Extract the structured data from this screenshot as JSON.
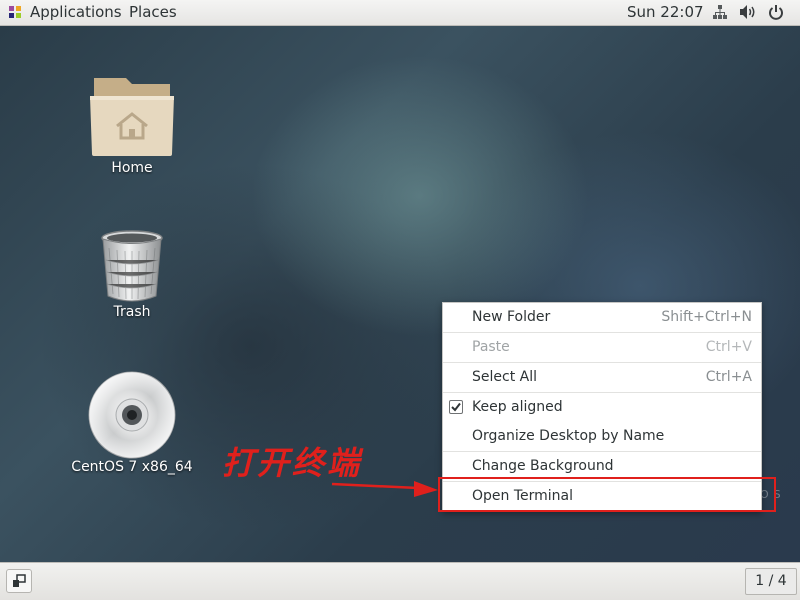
{
  "topbar": {
    "applications_label": "Applications",
    "places_label": "Places",
    "clock": "Sun 22:07",
    "tray_icons": [
      "network-icon",
      "volume-icon",
      "power-icon"
    ]
  },
  "desktop": {
    "icons": [
      {
        "label": "Home",
        "icon": "home-folder-icon"
      },
      {
        "label": "Trash",
        "icon": "trash-icon"
      },
      {
        "label": "CentOS 7 x86_64",
        "icon": "optical-disc-icon"
      }
    ],
    "watermark": "OS"
  },
  "context_menu": {
    "items": [
      {
        "label": "New Folder",
        "accel": "Shift+Ctrl+N",
        "enabled": true
      },
      {
        "label": "Paste",
        "accel": "Ctrl+V",
        "enabled": false
      },
      {
        "label": "Select All",
        "accel": "Ctrl+A",
        "enabled": true
      },
      {
        "label": "Keep aligned",
        "accel": "",
        "enabled": true,
        "checked": true
      },
      {
        "label": "Organize Desktop by Name",
        "accel": "",
        "enabled": true
      },
      {
        "label": "Change Background",
        "accel": "",
        "enabled": true
      },
      {
        "label": "Open Terminal",
        "accel": "",
        "enabled": true,
        "highlighted_by_annotation": true
      }
    ]
  },
  "annotation": {
    "text": "打开终端",
    "color": "#e0201c"
  },
  "bottombar": {
    "workspace_indicator": "1 / 4"
  }
}
